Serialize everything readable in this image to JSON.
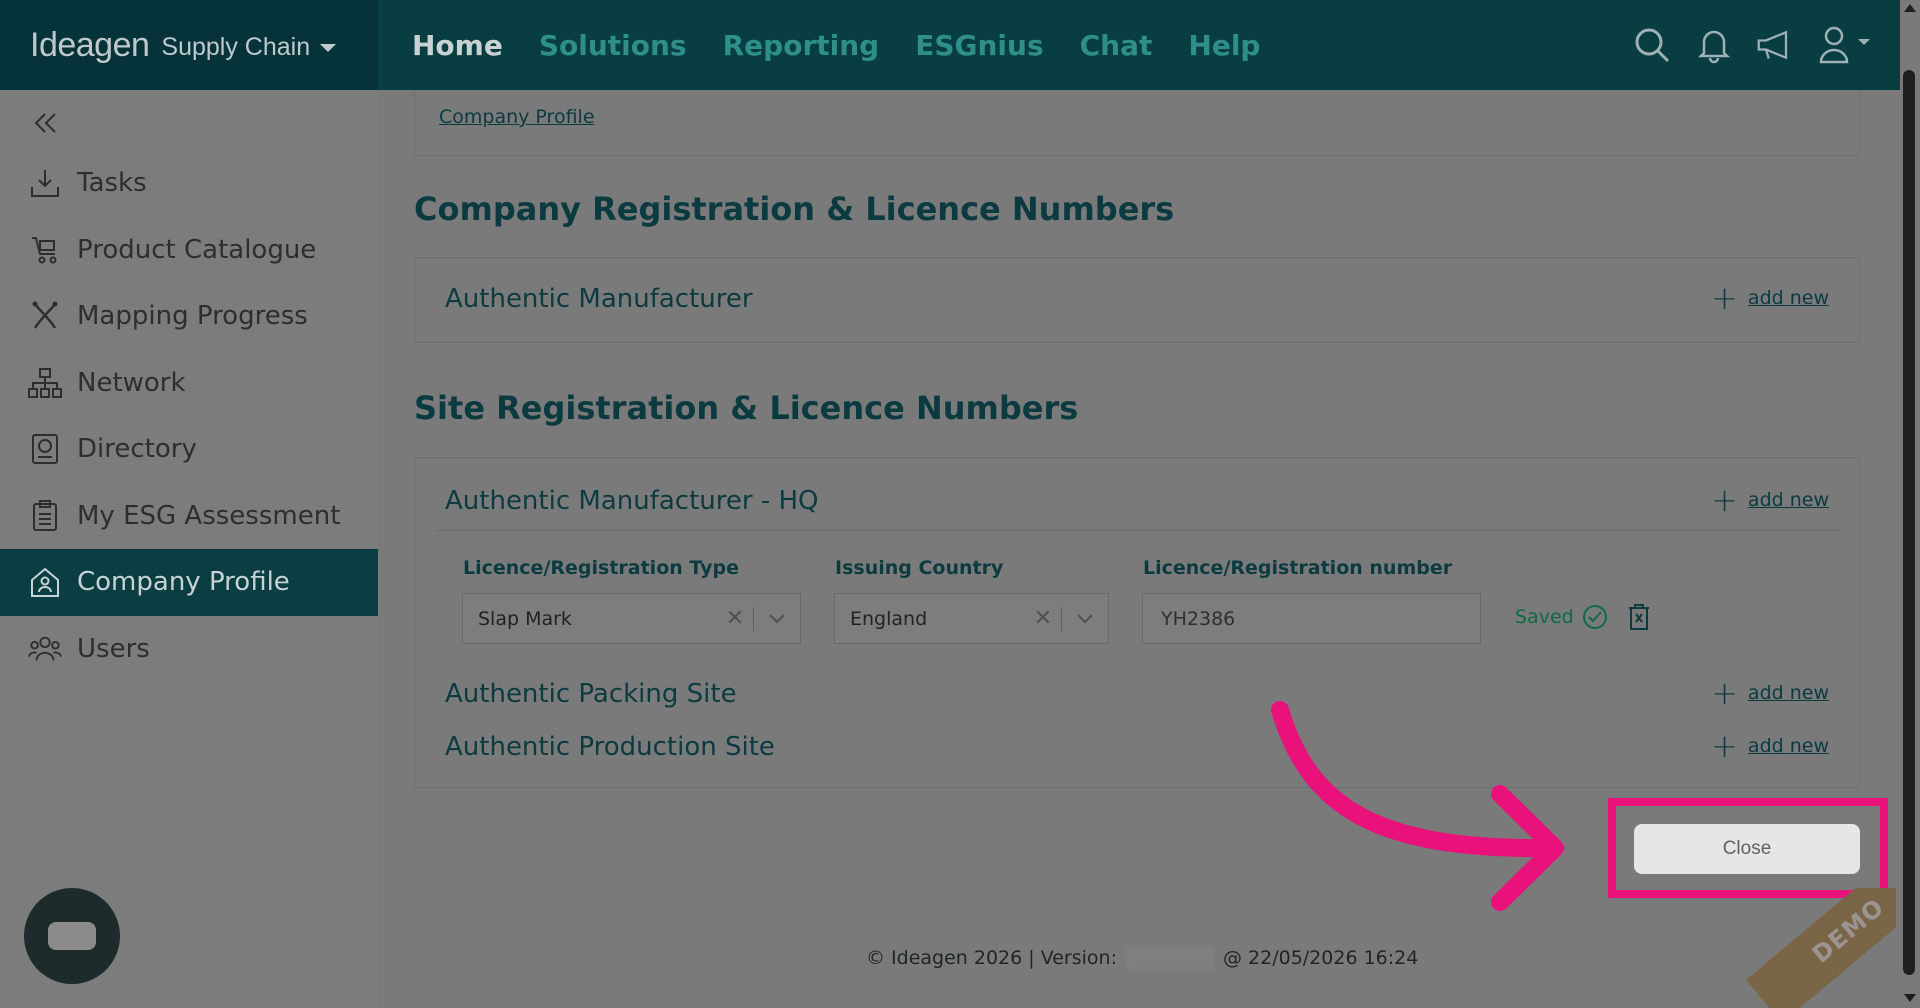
{
  "header": {
    "brand": "Ideagen",
    "product": "Supply Chain",
    "nav": [
      "Home",
      "Solutions",
      "Reporting",
      "ESGnius",
      "Chat",
      "Help"
    ],
    "icons": [
      "search-icon",
      "bell-icon",
      "megaphone-icon",
      "user-icon"
    ]
  },
  "sidebar": {
    "items": [
      {
        "label": "Tasks",
        "icon": "tasks-icon"
      },
      {
        "label": "Product Catalogue",
        "icon": "cart-icon"
      },
      {
        "label": "Mapping Progress",
        "icon": "mapping-icon"
      },
      {
        "label": "Network",
        "icon": "network-icon"
      },
      {
        "label": "Directory",
        "icon": "directory-icon"
      },
      {
        "label": "My ESG Assessment",
        "icon": "clipboard-icon"
      },
      {
        "label": "Company Profile",
        "icon": "company-icon"
      },
      {
        "label": "Users",
        "icon": "users-icon"
      }
    ],
    "active": "Company Profile"
  },
  "main": {
    "breadcrumb": "Company Profile",
    "company_section": {
      "title": "Company Registration & Licence Numbers",
      "rows": [
        {
          "name": "Authentic Manufacturer",
          "action": "add new"
        }
      ]
    },
    "site_section": {
      "title": "Site Registration & Licence Numbers",
      "rows": [
        {
          "name": "Authentic Manufacturer - HQ",
          "action": "add new"
        },
        {
          "name": "Authentic Packing Site",
          "action": "add new"
        },
        {
          "name": "Authentic Production Site",
          "action": "add new"
        }
      ],
      "form": {
        "type_label": "Licence/Registration Type",
        "type_value": "Slap Mark",
        "country_label": "Issuing Country",
        "country_value": "England",
        "number_label": "Licence/Registration number",
        "number_value": "YH2386",
        "status": "Saved"
      }
    },
    "close_label": "Close",
    "footer": {
      "prefix": "© Ideagen 2026 | Version:",
      "suffix": "@ 22/05/2026 16:24"
    },
    "demo_label": "DEMO"
  },
  "colors": {
    "dark_teal": "#083d42",
    "accent": "#e8127a",
    "saved_green": "#0d6b43"
  }
}
